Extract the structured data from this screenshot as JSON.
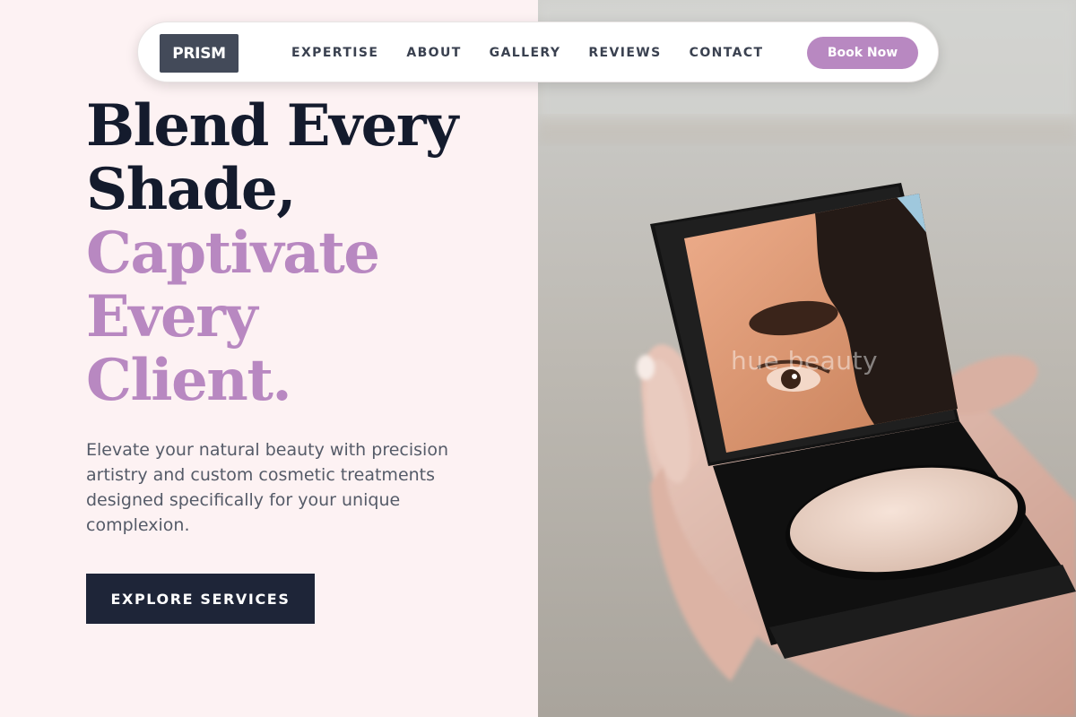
{
  "brand": {
    "logo_text": "PRISM"
  },
  "nav": {
    "links": [
      "EXPERTISE",
      "ABOUT",
      "GALLERY",
      "REVIEWS",
      "CONTACT"
    ],
    "book_label": "Book Now"
  },
  "hero": {
    "headline_dark": [
      "Blend Every",
      "Shade,"
    ],
    "headline_accent": [
      "Captivate",
      "Every",
      "Client."
    ],
    "description": "Elevate your natural beauty with precision artistry and custom cosmetic treatments designed specifically for your unique complexion.",
    "cta_label": "EXPLORE SERVICES",
    "image_watermark": "hue beauty"
  },
  "colors": {
    "accent": "#b888c1",
    "dark": "#141b2d",
    "cta_bg": "#1e2538",
    "logo_bg": "#434a59",
    "page_bg": "#fdf2f3"
  }
}
